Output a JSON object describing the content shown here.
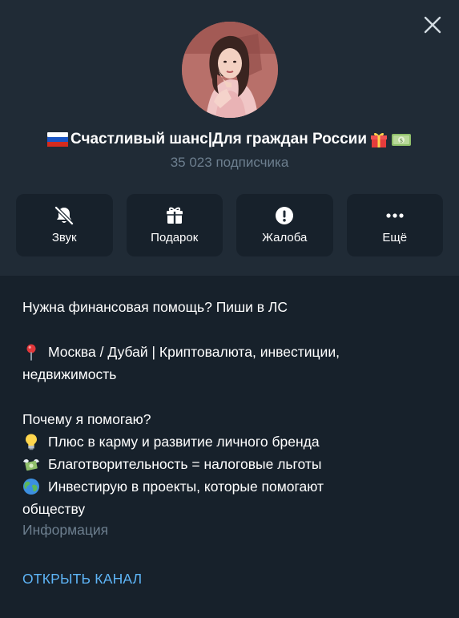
{
  "header": {
    "channel_title": "Счастливый шанс|Для граждан России",
    "subscribers": "35 023 подписчика",
    "close_icon": "close-icon",
    "title_emoji": [
      "russia-flag-icon",
      "gift-icon",
      "money-icon"
    ]
  },
  "actions": [
    {
      "label": "Звук",
      "icon": "bell-muted-icon"
    },
    {
      "label": "Подарок",
      "icon": "gift-icon"
    },
    {
      "label": "Жалоба",
      "icon": "warning-icon"
    },
    {
      "label": "Ещё",
      "icon": "more-icon"
    }
  ],
  "description": {
    "line1": "Нужна финансовая помощь? Пиши в ЛС",
    "line2": "Москва / Дубай | Криптовалюта, инвестиции,",
    "line3": "недвижимость",
    "line4": "Почему я помогаю?",
    "line5": "Плюс в карму и развитие личного бренда",
    "line6": "Благотворительность = налоговые льготы",
    "line7": "Инвестирую в проекты, которые помогают",
    "line8": "обществу",
    "emoji": [
      "pin-icon",
      "lightbulb-icon",
      "money-wings-icon",
      "globe-icon"
    ]
  },
  "info_label": "Информация",
  "open_channel_label": "ОТКРЫТЬ КАНАЛ",
  "colors": {
    "background": "#17212b",
    "header_background": "#202b36",
    "muted_text": "#6d7f8f",
    "link": "#5eb5f7"
  }
}
